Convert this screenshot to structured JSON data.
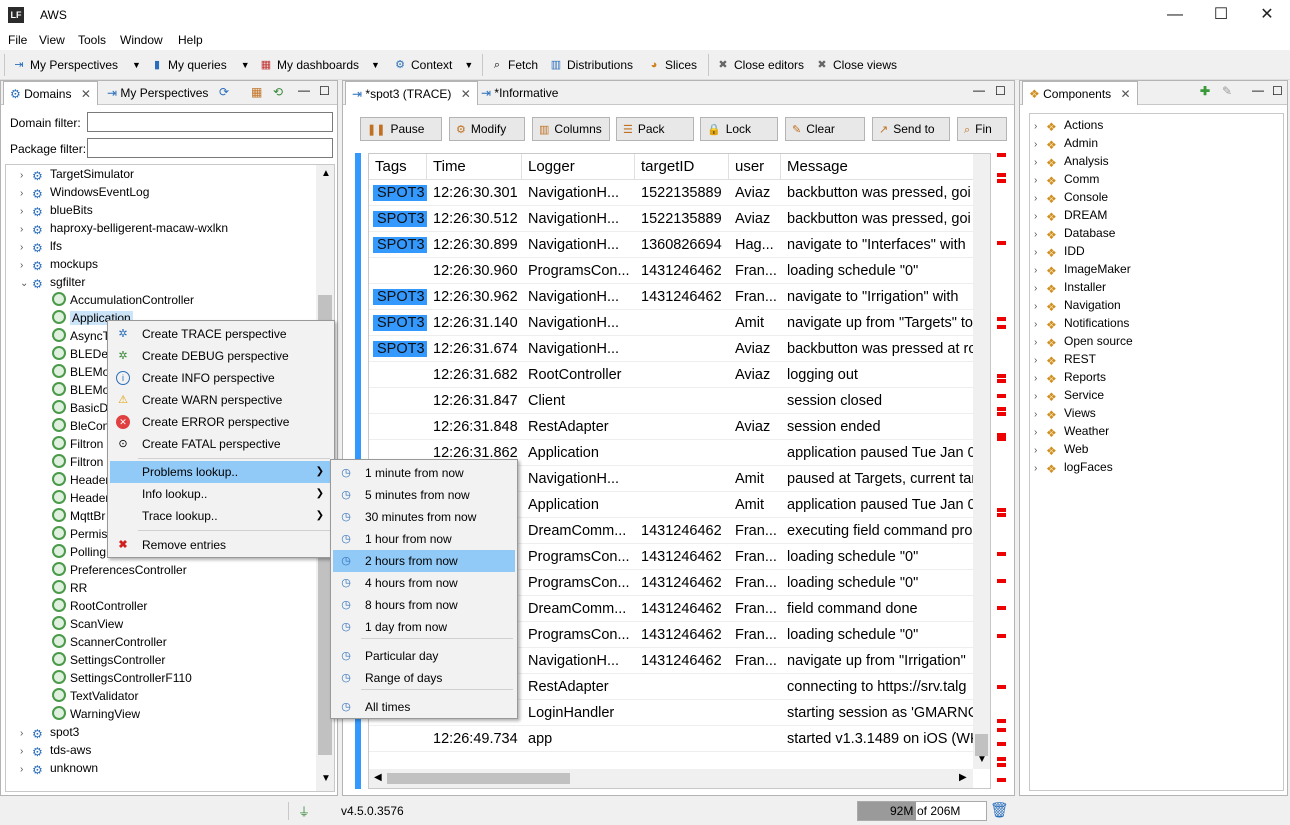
{
  "window": {
    "logo": "LF",
    "title": "AWS",
    "minimize": "—",
    "maximize": "☐",
    "close": "✕"
  },
  "menubar": [
    "File",
    "View",
    "Tools",
    "Window",
    "Help"
  ],
  "toolbar": {
    "my_perspectives": "My Perspectives",
    "my_queries": "My queries",
    "my_dashboards": "My dashboards",
    "context": "Context",
    "fetch": "Fetch",
    "distributions": "Distributions",
    "slices": "Slices",
    "close_editors": "Close editors",
    "close_views": "Close views"
  },
  "left_panel": {
    "tabs": [
      "Domains",
      "My Perspectives"
    ],
    "domain_filter_label": "Domain filter:",
    "package_filter_label": "Package filter:",
    "domain_filter_value": "",
    "package_filter_value": "",
    "domains_top": [
      "TargetSimulator",
      "WindowsEventLog",
      "blueBits",
      "haproxy-belligerent-macaw-wxlkn",
      "lfs",
      "mockups",
      "sgfilter"
    ],
    "sgfilter_children": [
      "AccumulationController",
      "Application",
      "AsyncT",
      "BLEDev",
      "BLEMo",
      "BLEMo",
      "BasicD",
      "BleCon",
      "Filtron",
      "Filtron",
      "Header",
      "Header",
      "MqttBr",
      "Permis",
      "Polling",
      "PreferencesController",
      "RR",
      "RootController",
      "ScanView",
      "ScannerController",
      "SettingsController",
      "SettingsControllerF110",
      "TextValidator",
      "WarningView"
    ],
    "domains_bottom": [
      "spot3",
      "tds-aws",
      "unknown"
    ]
  },
  "editor": {
    "tabs": [
      "*spot3 (TRACE)",
      "*Informative"
    ],
    "buttons": [
      "Pause",
      "Modify",
      "Columns",
      "Pack",
      "Lock",
      "Clear",
      "Send to",
      "Fin"
    ],
    "columns": [
      "Tags",
      "Time",
      "Logger",
      "targetID",
      "user",
      "Message"
    ],
    "rows": [
      {
        "tag": "SPOT3",
        "time": "12:26:30.301",
        "logger": "NavigationH...",
        "target": "1522135889",
        "user": "Aviaz",
        "msg": "backbutton was pressed, goi"
      },
      {
        "tag": "SPOT3",
        "time": "12:26:30.512",
        "logger": "NavigationH...",
        "target": "1522135889",
        "user": "Aviaz",
        "msg": "backbutton was pressed, goi"
      },
      {
        "tag": "SPOT3",
        "time": "12:26:30.899",
        "logger": "NavigationH...",
        "target": "1360826694",
        "user": "Hag...",
        "msg": "navigate to \"Interfaces\" with"
      },
      {
        "tag": "",
        "time": "12:26:30.960",
        "logger": "ProgramsCon...",
        "target": "1431246462",
        "user": "Fran...",
        "msg": "loading schedule \"0\""
      },
      {
        "tag": "SPOT3",
        "time": "12:26:30.962",
        "logger": "NavigationH...",
        "target": "1431246462",
        "user": "Fran...",
        "msg": "navigate to \"Irrigation\" with"
      },
      {
        "tag": "SPOT3",
        "time": "12:26:31.140",
        "logger": "NavigationH...",
        "target": "",
        "user": "Amit",
        "msg": "navigate up from \"Targets\" to"
      },
      {
        "tag": "SPOT3",
        "time": "12:26:31.674",
        "logger": "NavigationH...",
        "target": "",
        "user": "Aviaz",
        "msg": "backbutton was pressed at ro"
      },
      {
        "tag": "",
        "time": "12:26:31.682",
        "logger": "RootController",
        "target": "",
        "user": "Aviaz",
        "msg": "logging out"
      },
      {
        "tag": "",
        "time": "12:26:31.847",
        "logger": "Client",
        "target": "",
        "user": "",
        "msg": "session closed"
      },
      {
        "tag": "",
        "time": "12:26:31.848",
        "logger": "RestAdapter",
        "target": "",
        "user": "Aviaz",
        "msg": "session ended"
      },
      {
        "tag": "",
        "time": "12:26:31.862",
        "logger": "Application",
        "target": "",
        "user": "",
        "msg": "application paused Tue Jan 0"
      },
      {
        "tag": "",
        "time": "",
        "logger": "NavigationH...",
        "target": "",
        "user": "Amit",
        "msg": "paused at Targets, current tar"
      },
      {
        "tag": "",
        "time": "",
        "logger": "Application",
        "target": "",
        "user": "Amit",
        "msg": "application paused Tue Jan 0"
      },
      {
        "tag": "",
        "time": "",
        "logger": "DreamComm...",
        "target": "1431246462",
        "user": "Fran...",
        "msg": "executing field command pro"
      },
      {
        "tag": "",
        "time": "",
        "logger": "ProgramsCon...",
        "target": "1431246462",
        "user": "Fran...",
        "msg": "loading schedule \"0\""
      },
      {
        "tag": "",
        "time": "",
        "logger": "ProgramsCon...",
        "target": "1431246462",
        "user": "Fran...",
        "msg": "loading schedule \"0\""
      },
      {
        "tag": "",
        "time": "",
        "logger": "DreamComm...",
        "target": "1431246462",
        "user": "Fran...",
        "msg": "field command done"
      },
      {
        "tag": "",
        "time": "",
        "logger": "ProgramsCon...",
        "target": "1431246462",
        "user": "Fran...",
        "msg": "loading schedule \"0\""
      },
      {
        "tag": "",
        "time": "",
        "logger": "NavigationH...",
        "target": "1431246462",
        "user": "Fran...",
        "msg": "navigate up from \"Irrigation\""
      },
      {
        "tag": "",
        "time": "",
        "logger": "RestAdapter",
        "target": "",
        "user": "",
        "msg": "connecting to https://srv.talg"
      },
      {
        "tag": "",
        "time": "",
        "logger": "LoginHandler",
        "target": "",
        "user": "",
        "msg": "starting session as 'GMARNO"
      },
      {
        "tag": "",
        "time": "12:26:49.734",
        "logger": "app",
        "target": "",
        "user": "",
        "msg": "started v1.3.1489 on iOS (WK"
      }
    ]
  },
  "components": {
    "tab": "Components",
    "items": [
      "Actions",
      "Admin",
      "Analysis",
      "Comm",
      "Console",
      "DREAM",
      "Database",
      "IDD",
      "ImageMaker",
      "Installer",
      "Navigation",
      "Notifications",
      "Open source",
      "REST",
      "Reports",
      "Service",
      "Views",
      "Weather",
      "Web",
      "logFaces"
    ]
  },
  "context_menu": {
    "items": [
      "Create TRACE perspective",
      "Create DEBUG perspective",
      "Create INFO perspective",
      "Create WARN perspective",
      "Create ERROR perspective",
      "Create FATAL perspective",
      "Problems lookup..",
      "Info lookup..",
      "Trace lookup..",
      "Remove entries"
    ]
  },
  "submenu": {
    "items": [
      "1 minute from now",
      "5 minutes from now",
      "30 minutes from now",
      "1 hour from now",
      "2 hours from now",
      "4 hours from now",
      "8 hours from now",
      "1 day from now",
      "Particular day",
      "Range of days",
      "All times"
    ],
    "highlighted": "2 hours from now"
  },
  "status": {
    "version": "v4.5.0.3576",
    "memory_used": "92M",
    "memory_total": "of 206M"
  },
  "colors": {
    "selection": "#91c9f7",
    "tag": "#3399ff",
    "error_marker": "#e00000"
  }
}
